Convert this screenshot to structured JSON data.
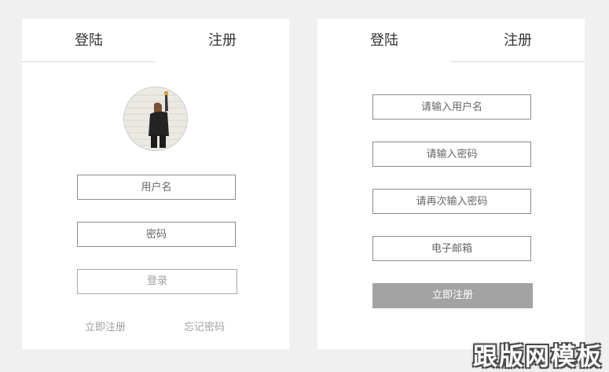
{
  "login_card": {
    "tab_login": "登陆",
    "tab_register": "注册",
    "username_placeholder": "用户名",
    "password_placeholder": "密码",
    "login_button": "登录",
    "register_link": "立即注册",
    "forgot_link": "忘记密码"
  },
  "register_card": {
    "tab_login": "登陆",
    "tab_register": "注册",
    "username_placeholder": "请输入用户名",
    "password_placeholder": "请输入密码",
    "confirm_placeholder": "请再次输入密码",
    "email_placeholder": "电子邮箱",
    "register_button": "立即注册"
  },
  "watermark": "跟版网模板"
}
